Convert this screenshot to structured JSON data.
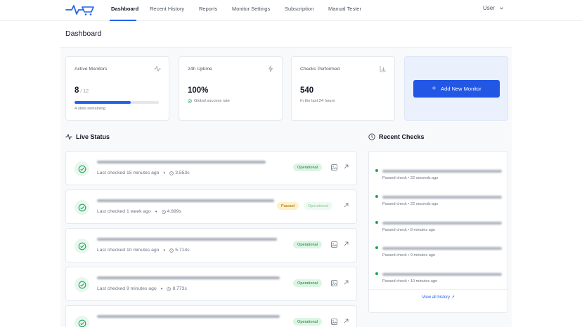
{
  "nav": {
    "items": [
      {
        "label": "Dashboard",
        "active": true
      },
      {
        "label": "Recent History",
        "active": false
      },
      {
        "label": "Reports",
        "active": false
      },
      {
        "label": "Monitor Settings",
        "active": false
      },
      {
        "label": "Subscription",
        "active": false
      },
      {
        "label": "Manual Tester",
        "active": false
      }
    ],
    "user_label": "User",
    "logo_icon": "heartbeat-cart-icon"
  },
  "page": {
    "title": "Dashboard"
  },
  "stats": {
    "active_monitors": {
      "label": "Active Monitors",
      "value": "8",
      "total": "/ 12",
      "progress_fraction": 0.667,
      "sub": "4 slots remaining",
      "icon": "activity-icon"
    },
    "uptime": {
      "label": "24h Uptime",
      "value": "100%",
      "sub": "Global success rate",
      "icon": "pulse-icon"
    },
    "checks": {
      "label": "Checks Performed",
      "value": "540",
      "sub": "In the last 24 hours",
      "icon": "bar-chart-icon"
    },
    "add_button": "Add New Monitor"
  },
  "live_status": {
    "title": "Live Status",
    "monitors": [
      {
        "last_checked": "Last checked 15 minutes ago",
        "duration": "3.553s",
        "badges": [
          "Operational"
        ]
      },
      {
        "last_checked": "Last checked 1 week ago",
        "duration": "4.899s",
        "badges": [
          "Paused",
          "Operational"
        ]
      },
      {
        "last_checked": "Last checked 10 minutes ago",
        "duration": "5.714s",
        "badges": [
          "Operational"
        ]
      },
      {
        "last_checked": "Last checked 9 minutes ago",
        "duration": "8.773s",
        "badges": [
          "Operational"
        ]
      },
      {
        "last_checked": "",
        "duration": "",
        "badges": [
          "Operational"
        ]
      }
    ]
  },
  "recent_checks": {
    "title": "Recent Checks",
    "items": [
      {
        "meta": "Passed check • 22 seconds ago"
      },
      {
        "meta": "Passed check • 22 seconds ago"
      },
      {
        "meta": "Passed check • 8 minutes ago"
      },
      {
        "meta": "Passed check • 9 minutes ago"
      },
      {
        "meta": "Passed check • 10 minutes ago"
      }
    ],
    "view_all": "View all history ↗"
  },
  "colors": {
    "accent": "#2563eb",
    "success": "#22a35a",
    "paused": "#a16207"
  }
}
